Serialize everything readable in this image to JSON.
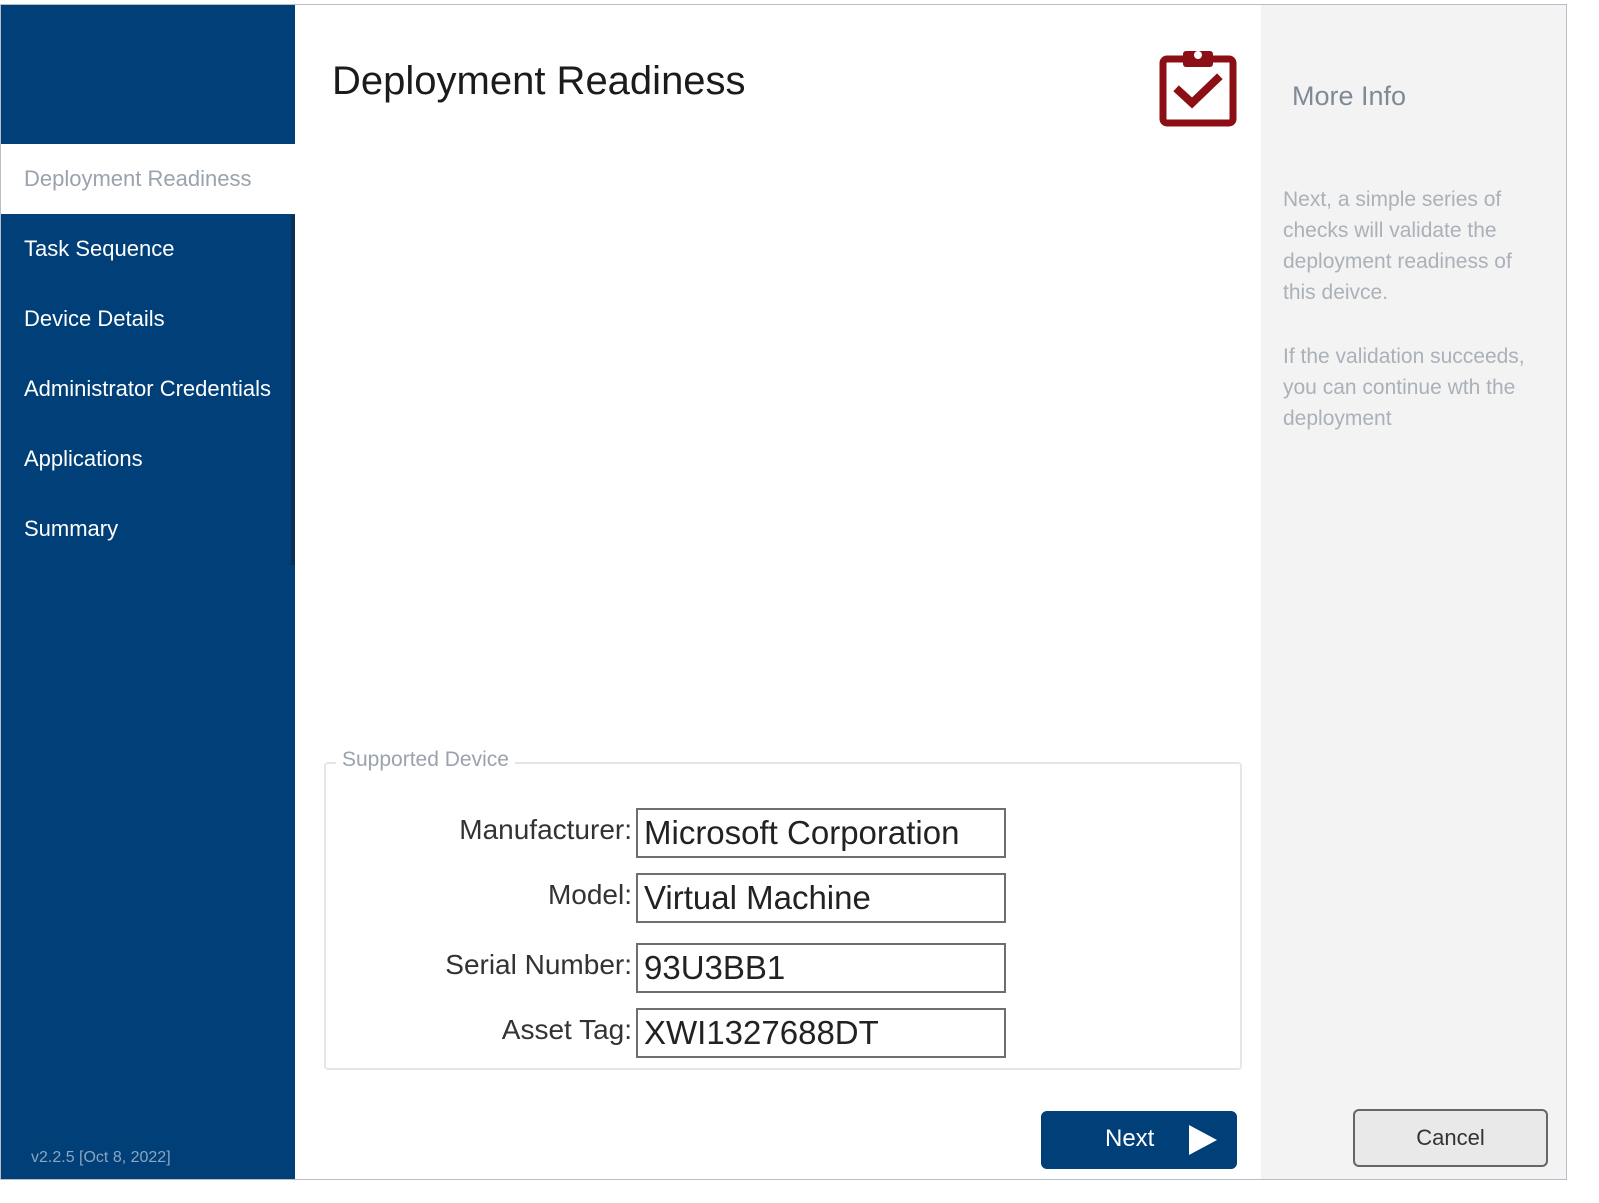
{
  "sidebar": {
    "items": [
      {
        "label": "Deployment Readiness"
      },
      {
        "label": "Task Sequence"
      },
      {
        "label": "Device Details"
      },
      {
        "label": "Administrator Credentials"
      },
      {
        "label": "Applications"
      },
      {
        "label": "Summary"
      }
    ],
    "version": "v2.2.5 [Oct 8, 2022]"
  },
  "main": {
    "title": "Deployment Readiness",
    "icon": "clipboard-check-icon",
    "group": {
      "legend": "Supported Device",
      "fields": [
        {
          "label": "Manufacturer:",
          "value": "Microsoft Corporation"
        },
        {
          "label": "Model:",
          "value": "Virtual Machine"
        },
        {
          "label": "Serial Number:",
          "value": "93U3BB1"
        },
        {
          "label": "Asset Tag:",
          "value": "XWI1327688DT"
        }
      ]
    },
    "next_label": "Next"
  },
  "info": {
    "title": "More Info",
    "paragraph1": "Next, a simple series of checks will validate the deployment readiness of this deivce.",
    "paragraph2": "If the validation succeeds, you can continue wth the deployment"
  },
  "footer": {
    "cancel_label": "Cancel"
  },
  "colors": {
    "sidebar_bg": "#003f77",
    "accent_icon": "#8b0f14",
    "info_panel_bg": "#f3f3f3"
  }
}
